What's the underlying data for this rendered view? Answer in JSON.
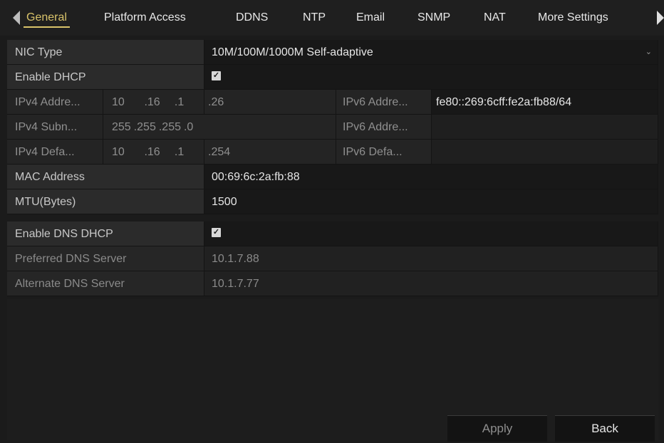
{
  "tabs": [
    {
      "label": "General",
      "active": true
    },
    {
      "label": "Platform Access",
      "active": false
    },
    {
      "label": "DDNS",
      "active": false
    },
    {
      "label": "NTP",
      "active": false
    },
    {
      "label": "Email",
      "active": false
    },
    {
      "label": "SNMP",
      "active": false
    },
    {
      "label": "NAT",
      "active": false
    },
    {
      "label": "More Settings",
      "active": false
    }
  ],
  "nic_type": {
    "label": "NIC Type",
    "value": "10M/100M/1000M Self-adaptive"
  },
  "enable_dhcp": {
    "label": "Enable DHCP",
    "checked": true,
    "mark": "✓"
  },
  "ipv4_address": {
    "label": "IPv4 Addre...",
    "segments": [
      "10",
      ".16",
      ".1",
      ".26"
    ]
  },
  "ipv4_subnet": {
    "label": "IPv4 Subn...",
    "segments": [
      "255",
      ".255",
      ".255",
      ".0"
    ]
  },
  "ipv4_gateway": {
    "label": "IPv4 Defa...",
    "segments": [
      "10",
      ".16",
      ".1",
      ".254"
    ]
  },
  "ipv6_address1": {
    "label": "IPv6 Addre...",
    "value": "fe80::269:6cff:fe2a:fb88/64"
  },
  "ipv6_address2": {
    "label": "IPv6 Addre...",
    "value": ""
  },
  "ipv6_gateway": {
    "label": "IPv6 Defa...",
    "value": ""
  },
  "mac_address": {
    "label": "MAC Address",
    "value": "00:69:6c:2a:fb:88"
  },
  "mtu": {
    "label": "MTU(Bytes)",
    "value": "1500"
  },
  "enable_dns_dhcp": {
    "label": "Enable DNS DHCP",
    "checked": true,
    "mark": "✓"
  },
  "preferred_dns": {
    "label": "Preferred DNS Server",
    "value": "10.1.7.88"
  },
  "alternate_dns": {
    "label": "Alternate DNS Server",
    "value": "10.1.7.77"
  },
  "buttons": {
    "apply": "Apply",
    "back": "Back"
  }
}
